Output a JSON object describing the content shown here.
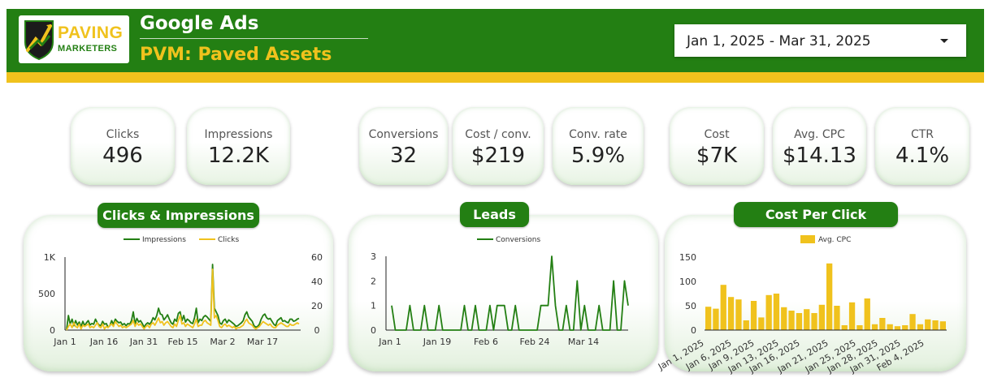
{
  "header": {
    "logo": {
      "word1": "PAVING",
      "word2": "MARKETERS"
    },
    "title": "Google Ads",
    "subtitle": "PVM: Paved Assets",
    "date_range": "Jan 1, 2025 - Mar 31, 2025",
    "colors": {
      "green": "#237f13",
      "gold": "#f0c21d"
    }
  },
  "kpis": [
    {
      "label": "Clicks",
      "value": "496"
    },
    {
      "label": "Impressions",
      "value": "12.2K"
    },
    {
      "label": "Conversions",
      "value": "32"
    },
    {
      "label": "Cost / conv.",
      "value": "$219"
    },
    {
      "label": "Conv. rate",
      "value": "5.9%"
    },
    {
      "label": "Cost",
      "value": "$7K"
    },
    {
      "label": "Avg. CPC",
      "value": "$14.13"
    },
    {
      "label": "CTR",
      "value": "4.1%"
    }
  ],
  "chart_data": [
    {
      "type": "line",
      "title": "Clicks & Impressions",
      "x_ticks": [
        "Jan 1",
        "Jan 16",
        "Jan 31",
        "Feb 15",
        "Mar 2",
        "Mar 17"
      ],
      "y_left_ticks": [
        "0",
        "500",
        "1K"
      ],
      "y_right_ticks": [
        "0",
        "20",
        "40",
        "60"
      ],
      "y_left_range": [
        0,
        1000
      ],
      "y_right_range": [
        0,
        60
      ],
      "legend_position": "top",
      "series": [
        {
          "name": "Impressions",
          "axis": "left",
          "color": "#237f13",
          "values": [
            10,
            200,
            80,
            150,
            60,
            130,
            70,
            110,
            50,
            120,
            60,
            100,
            130,
            70,
            90,
            80,
            150,
            100,
            70,
            60,
            120,
            80,
            90,
            40,
            60,
            130,
            80,
            150,
            120,
            100,
            110,
            70,
            90,
            60,
            90,
            80,
            130,
            250,
            90,
            160,
            110,
            130,
            90,
            40,
            80,
            100,
            80,
            110,
            170,
            140,
            200,
            300,
            220,
            210,
            140,
            170,
            210,
            150,
            100,
            80,
            150,
            120,
            230,
            250,
            130,
            200,
            110,
            150,
            130,
            100,
            90,
            170,
            300,
            100,
            150,
            130,
            180,
            200,
            180,
            150,
            120,
            900,
            300,
            250,
            200,
            100,
            80,
            130,
            150,
            100,
            140,
            120,
            100,
            80,
            50,
            60,
            80,
            100,
            130,
            210,
            250,
            180,
            150,
            120,
            60,
            40,
            50,
            80,
            150,
            200,
            220,
            170,
            150,
            160,
            120,
            80,
            60,
            130,
            150,
            170,
            120,
            130,
            110,
            100,
            150,
            150,
            120,
            130,
            150,
            160
          ]
        },
        {
          "name": "Clicks",
          "axis": "right",
          "color": "#f0c21d",
          "values": [
            0,
            3,
            5,
            2,
            6,
            3,
            2,
            5,
            1,
            4,
            3,
            4,
            5,
            2,
            3,
            2,
            4,
            6,
            3,
            2,
            5,
            1,
            3,
            2,
            4,
            5,
            3,
            7,
            5,
            3,
            4,
            2,
            3,
            2,
            3,
            4,
            5,
            8,
            3,
            6,
            4,
            5,
            3,
            1,
            3,
            4,
            2,
            5,
            6,
            4,
            7,
            10,
            6,
            7,
            4,
            6,
            7,
            5,
            3,
            2,
            5,
            3,
            8,
            12,
            5,
            6,
            3,
            5,
            4,
            3,
            2,
            5,
            9,
            3,
            4,
            4,
            7,
            8,
            6,
            5,
            4,
            50,
            10,
            12,
            8,
            3,
            2,
            4,
            5,
            3,
            4,
            3,
            2,
            3,
            1,
            2,
            2,
            3,
            4,
            7,
            9,
            6,
            5,
            4,
            2,
            1,
            2,
            3,
            5,
            7,
            6,
            5,
            4,
            5,
            3,
            2,
            2,
            4,
            5,
            6,
            5,
            4,
            3,
            3,
            5,
            4,
            4,
            5,
            6,
            5
          ]
        }
      ]
    },
    {
      "type": "line",
      "title": "Leads",
      "x_ticks": [
        "Jan 1",
        "Jan 19",
        "Feb 6",
        "Feb 24",
        "Mar 14"
      ],
      "y_ticks": [
        "0",
        "1",
        "2",
        "3"
      ],
      "y_range": [
        0,
        3
      ],
      "legend_position": "top",
      "series": [
        {
          "name": "Conversions",
          "color": "#237f13",
          "values": [
            1,
            0,
            0,
            0,
            0,
            1,
            0,
            0,
            0,
            1,
            0,
            0,
            0,
            1,
            0,
            0,
            0,
            0,
            0,
            0,
            1,
            0,
            0,
            1,
            0,
            0,
            0,
            1,
            0,
            1,
            1,
            1,
            0,
            0,
            1,
            0,
            0,
            0,
            0,
            0,
            0,
            1,
            1,
            1,
            3,
            1,
            0,
            0,
            1,
            0,
            0,
            2,
            0,
            1,
            0,
            0,
            0,
            1,
            0,
            0,
            0,
            2,
            0,
            0,
            2,
            1
          ]
        }
      ]
    },
    {
      "type": "bar",
      "title": "Cost Per Click",
      "x_ticks": [
        "Jan 1, 2025",
        "Jan 6, 2025",
        "Jan 9, 2025",
        "Jan 13, 2025",
        "Jan 16, 2025",
        "Jan 21, 2025",
        "Jan 25, 2025",
        "Jan 28, 2025",
        "Jan 31, 2025",
        "Feb 4, 2025"
      ],
      "y_ticks": [
        "0",
        "50",
        "100",
        "150"
      ],
      "y_range": [
        0,
        150
      ],
      "legend_position": "top",
      "series": [
        {
          "name": "Avg. CPC",
          "color": "#f0c21d",
          "values": [
            48,
            44,
            93,
            68,
            63,
            20,
            60,
            26,
            72,
            75,
            47,
            40,
            35,
            43,
            35,
            52,
            137,
            50,
            10,
            57,
            10,
            65,
            12,
            25,
            12,
            8,
            10,
            33,
            12,
            22,
            20,
            18
          ]
        }
      ]
    }
  ]
}
